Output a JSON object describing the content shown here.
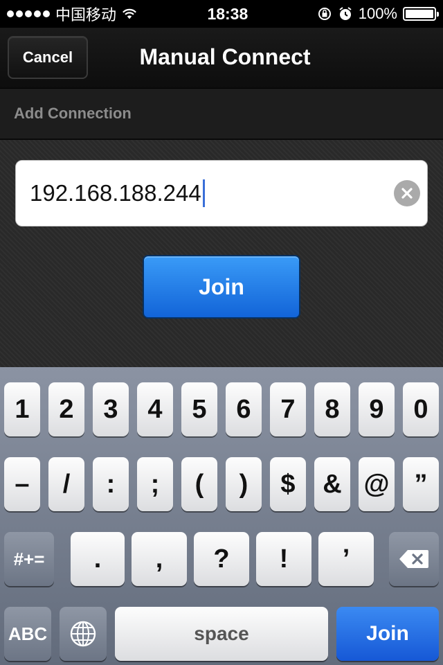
{
  "status_bar": {
    "carrier": "中国移动",
    "time": "18:38",
    "battery": "100%",
    "battery_level": 1.0
  },
  "nav": {
    "cancel_label": "Cancel",
    "title": "Manual Connect"
  },
  "section": {
    "header": "Add Connection"
  },
  "form": {
    "ip_value": "192.168.188.244",
    "join_label": "Join"
  },
  "keyboard": {
    "row1": [
      "1",
      "2",
      "3",
      "4",
      "5",
      "6",
      "7",
      "8",
      "9",
      "0"
    ],
    "row2": [
      "–",
      "/",
      ":",
      ";",
      "(",
      ")",
      "$",
      "&",
      "@",
      "”"
    ],
    "row3": [
      ".",
      ",",
      "?",
      "!",
      "’"
    ],
    "symbols_label": "#+=",
    "abc_label": "ABC",
    "space_label": "space",
    "return_label": "Join"
  },
  "colors": {
    "accent": "#1a73e8",
    "keyboard_bg": "#7a8292"
  }
}
